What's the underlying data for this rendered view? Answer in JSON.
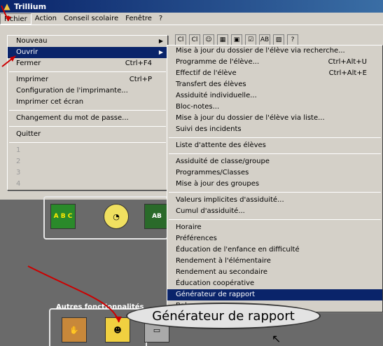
{
  "window": {
    "title": "Trillium"
  },
  "menubar": {
    "items": [
      "Fichier",
      "Action",
      "Conseil scolaire",
      "Fenêtre",
      "?"
    ]
  },
  "toolbar": {
    "icons": [
      "Cl",
      "Cl",
      "☺",
      "▦",
      "▣",
      "☑",
      "AB",
      "▨",
      "?"
    ]
  },
  "file_menu": {
    "items": [
      {
        "label": "Nouveau",
        "submenu": true
      },
      {
        "label": "Ouvrir",
        "submenu": true,
        "highlighted": true
      },
      {
        "label": "Fermer",
        "shortcut": "Ctrl+F4"
      },
      {
        "sep": true
      },
      {
        "label": "Imprimer",
        "shortcut": "Ctrl+P"
      },
      {
        "label": "Configuration de l'imprimante..."
      },
      {
        "label": "Imprimer cet écran"
      },
      {
        "sep": true
      },
      {
        "label": "Changement du mot de passe..."
      },
      {
        "sep": true
      },
      {
        "label": "Quitter"
      },
      {
        "sep": true
      },
      {
        "label": "1",
        "disabled": true
      },
      {
        "label": "2",
        "disabled": true
      },
      {
        "label": "3",
        "disabled": true
      },
      {
        "label": "4",
        "disabled": true
      }
    ]
  },
  "open_submenu": {
    "items": [
      {
        "label": "Mise à jour du dossier de l'élève via recherche..."
      },
      {
        "label": "Programme de l'élève...",
        "shortcut": "Ctrl+Alt+U"
      },
      {
        "label": "Effectif de l'élève",
        "shortcut": "Ctrl+Alt+E"
      },
      {
        "label": "Transfert des élèves"
      },
      {
        "label": "Assiduité individuelle..."
      },
      {
        "label": "Bloc-notes..."
      },
      {
        "label": "Mise à jour du dossier de l'élève via liste..."
      },
      {
        "label": "Suivi des incidents"
      },
      {
        "sep": true
      },
      {
        "label": "Liste d'attente des élèves"
      },
      {
        "sep": true
      },
      {
        "label": "Assiduité de classe/groupe"
      },
      {
        "label": "Programmes/Classes"
      },
      {
        "label": "Mise à jour des groupes"
      },
      {
        "sep": true
      },
      {
        "label": "Valeurs implicites d'assiduité..."
      },
      {
        "label": "Cumul d'assiduité..."
      },
      {
        "sep": true
      },
      {
        "label": "Horaire"
      },
      {
        "label": "Préférences"
      },
      {
        "label": "Éducation de l'enfance en difficulté"
      },
      {
        "label": "Rendement à l'élémentaire"
      },
      {
        "label": "Rendement au secondaire"
      },
      {
        "label": "Éducation coopérative"
      },
      {
        "label": "Générateur de rapport",
        "highlighted": true
      },
      {
        "label": "Balayage"
      }
    ]
  },
  "desktop": {
    "other_functions_label": "Autres fonctionnalités",
    "icon_abc": "A B C"
  },
  "callout": {
    "text": "Générateur de rapport"
  }
}
